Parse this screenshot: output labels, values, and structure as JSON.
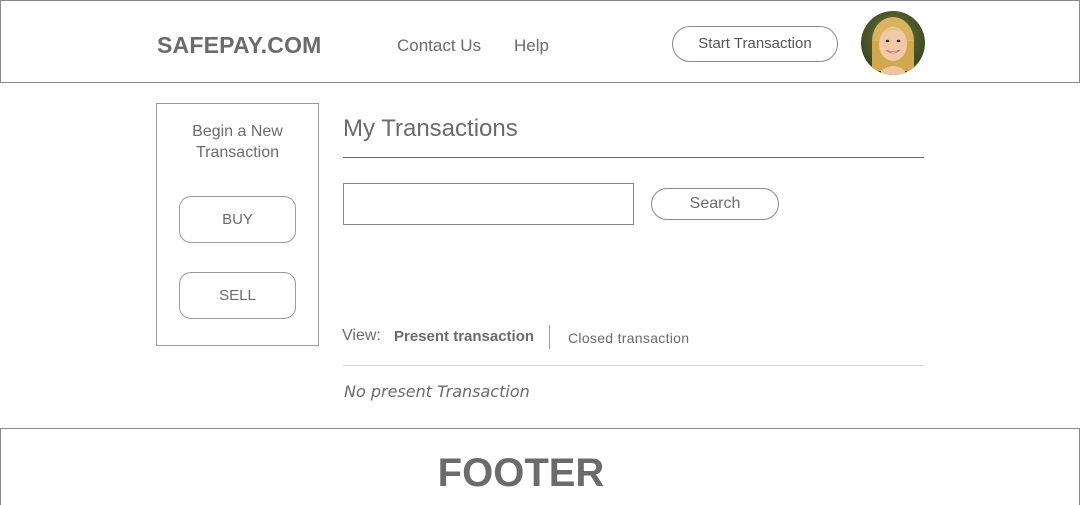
{
  "header": {
    "brand": "SAFEPAY.COM",
    "nav": {
      "contact": "Contact Us",
      "help": "Help"
    },
    "start_transaction": "Start Transaction"
  },
  "sidebar": {
    "title_line1": "Begin a New",
    "title_line2": "Transaction",
    "buy": "BUY",
    "sell": "SELL"
  },
  "main": {
    "title": "My Transactions",
    "search": {
      "value": "",
      "button": "Search"
    },
    "view_label": "View:",
    "tabs": {
      "present": "Present transaction",
      "closed": "Closed transaction"
    },
    "empty_message": "No present Transaction"
  },
  "footer": {
    "text": "FOOTER"
  }
}
